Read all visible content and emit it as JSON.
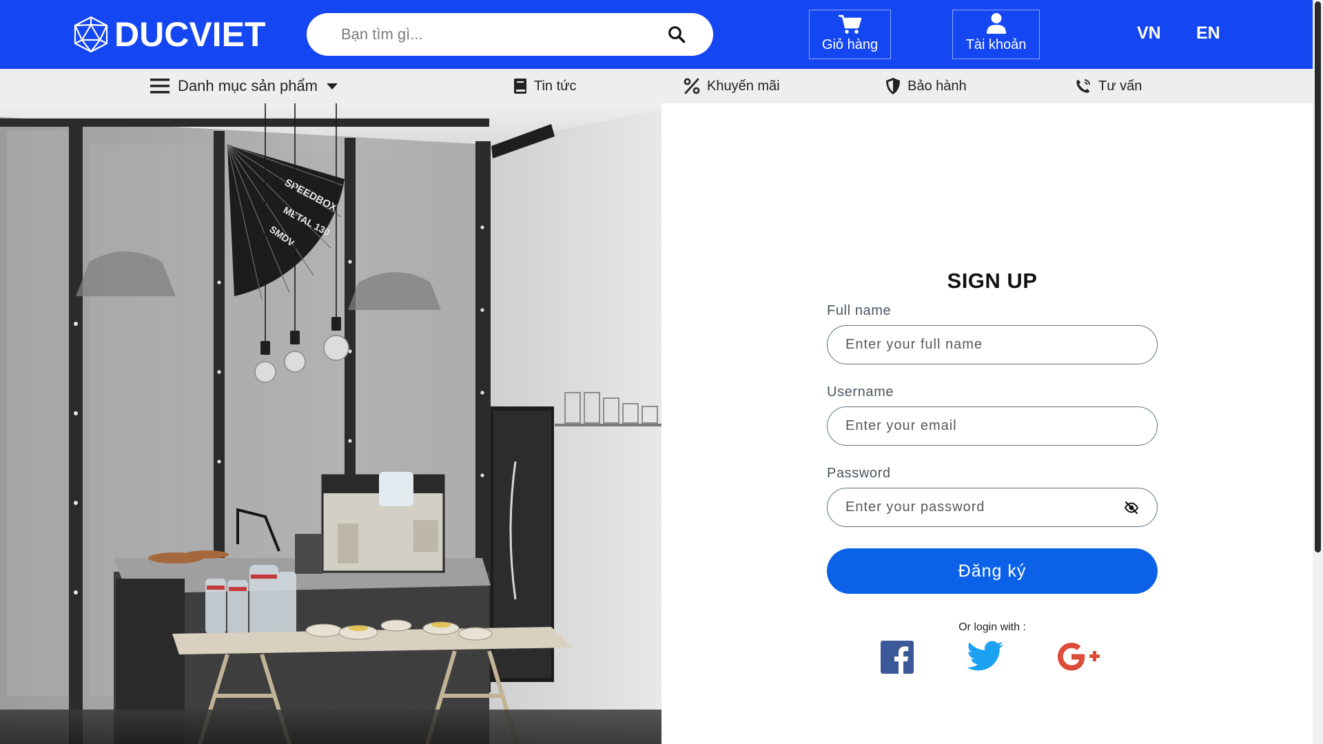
{
  "header": {
    "logo_text": "DUCVIET",
    "search_placeholder": "Bạn tìm gì...",
    "cart_label": "Giỏ hàng",
    "account_label": "Tài khoản",
    "lang_vn": "VN",
    "lang_en": "EN",
    "brand_color": "#1446f2"
  },
  "nav": {
    "category_label": "Danh mục sản phẩm",
    "news_label": "Tin tức",
    "promo_label": "Khuyến mãi",
    "warranty_label": "Bảo hành",
    "consult_label": "Tư vấn"
  },
  "hero_image": {
    "texts": [
      "SPEEDBOX",
      "METAL 130",
      "SMDV"
    ]
  },
  "signup": {
    "title": "SIGN UP",
    "fullname_label": "Full name",
    "fullname_placeholder": "Enter your full name",
    "username_label": "Username",
    "username_placeholder": "Enter your email",
    "password_label": "Password",
    "password_placeholder": "Enter your password",
    "submit_label": "Đăng ký",
    "or_login_text": "Or login with :",
    "button_color": "#0b62e8",
    "social_icons": [
      "facebook-icon",
      "twitter-icon",
      "google-plus-icon"
    ]
  }
}
